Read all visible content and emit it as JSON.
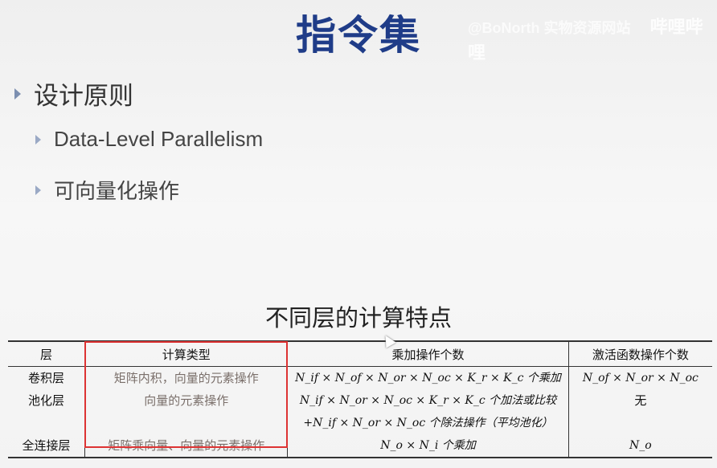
{
  "slide": {
    "title": "指令集",
    "watermark": "哔哩哔哩",
    "watermark_text": "@BoNorth 实物资源网站"
  },
  "bullets": {
    "level1": "设计原则",
    "level2": [
      "Data-Level Parallelism",
      "可向量化操作"
    ]
  },
  "table": {
    "title": "不同层的计算特点",
    "headers": [
      "层",
      "计算类型",
      "乘加操作个数",
      "激活函数操作个数"
    ],
    "rows": [
      {
        "layer": "卷积层",
        "compute": "矩阵内积，向量的元素操作",
        "mac": "N_if × N_of × N_or × N_oc × K_r × K_c 个乘加",
        "act": "N_of × N_or × N_oc"
      },
      {
        "layer": "池化层",
        "compute": "向量的元素操作",
        "mac": "N_if × N_or × N_oc × K_r × K_c 个加法或比较",
        "act": "无"
      },
      {
        "layer": "",
        "compute": "",
        "mac": "+N_if × N_or × N_oc 个除法操作（平均池化）",
        "act": ""
      },
      {
        "layer": "全连接层",
        "compute": "矩阵乘向量、向量的元素操作",
        "mac": "N_o × N_i 个乘加",
        "act": "N_o"
      }
    ]
  },
  "colors": {
    "title": "#1f3c88",
    "highlight_box": "#dd3333",
    "bullet_marker": "#7c8fb0"
  }
}
